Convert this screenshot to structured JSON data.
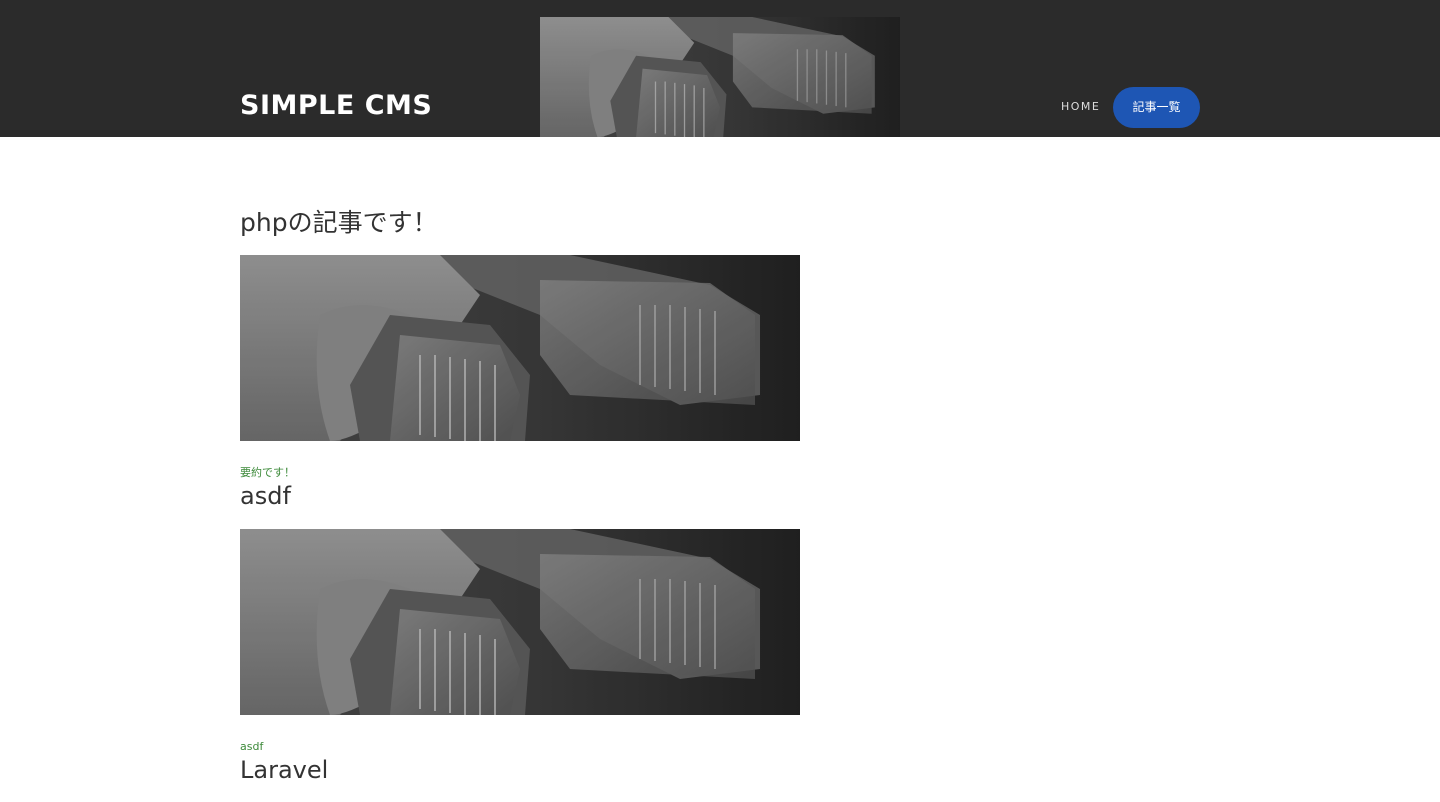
{
  "header": {
    "site_title": "SIMPLE CMS",
    "nav": {
      "home_label": "HOME",
      "articles_label": "記事一覧"
    }
  },
  "main": {
    "page_heading": "phpの記事です！",
    "articles": [
      {
        "summary": "要約です！",
        "title": "asdf"
      },
      {
        "summary": "asdf",
        "title": "Laravel"
      }
    ]
  },
  "colors": {
    "header_bg": "#2b2b2b",
    "accent_button": "#1e56b4",
    "summary_text": "#3d8a3a"
  },
  "icons": {
    "article_thumbnail": "ethernet-cable-photo"
  }
}
